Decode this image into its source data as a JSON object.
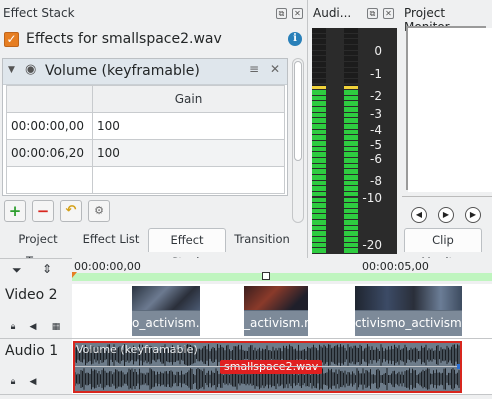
{
  "effect_stack": {
    "title": "Effect Stack",
    "effects_for_label": "Effects for smallspace2.wav",
    "effect_name": "Volume (keyframable)",
    "table": {
      "column_header": "Gain",
      "rows": [
        {
          "time": "00:00:00,00",
          "gain": "100"
        },
        {
          "time": "00:00:06,20",
          "gain": "100"
        }
      ]
    },
    "tabs": [
      "Project Tree",
      "Effect List",
      "Effect Stack",
      "Transition"
    ],
    "active_tab": "Effect Stack"
  },
  "audio_meter": {
    "title": "Audi...",
    "scale": [
      "0",
      "-1",
      "-2",
      "-3",
      "-4",
      "-5",
      "-6",
      "-8",
      "-10",
      "-20"
    ],
    "level_left": 0.72,
    "level_right": 0.72
  },
  "project_monitor": {
    "title": "Project Monitor",
    "tab": "Clip Monitor"
  },
  "timeline": {
    "ruler_start": "00:00:00,00",
    "ruler_mid": "00:00:05,00",
    "tracks": [
      {
        "name": "Video 2",
        "clips": [
          {
            "label": "o_activism.m"
          },
          {
            "label": "_activism.m"
          },
          {
            "label": "ctivismo_activism.m"
          }
        ]
      },
      {
        "name": "Audio 1",
        "clip": {
          "effect_label": "Volume (keyframable)",
          "name": "smallspace2.wav"
        }
      }
    ]
  },
  "colors": {
    "accent_orange": "#e67e22",
    "meter_green": "#2ecc40",
    "clip_red": "#d8261e",
    "ruler_green": "#bff5bf"
  }
}
